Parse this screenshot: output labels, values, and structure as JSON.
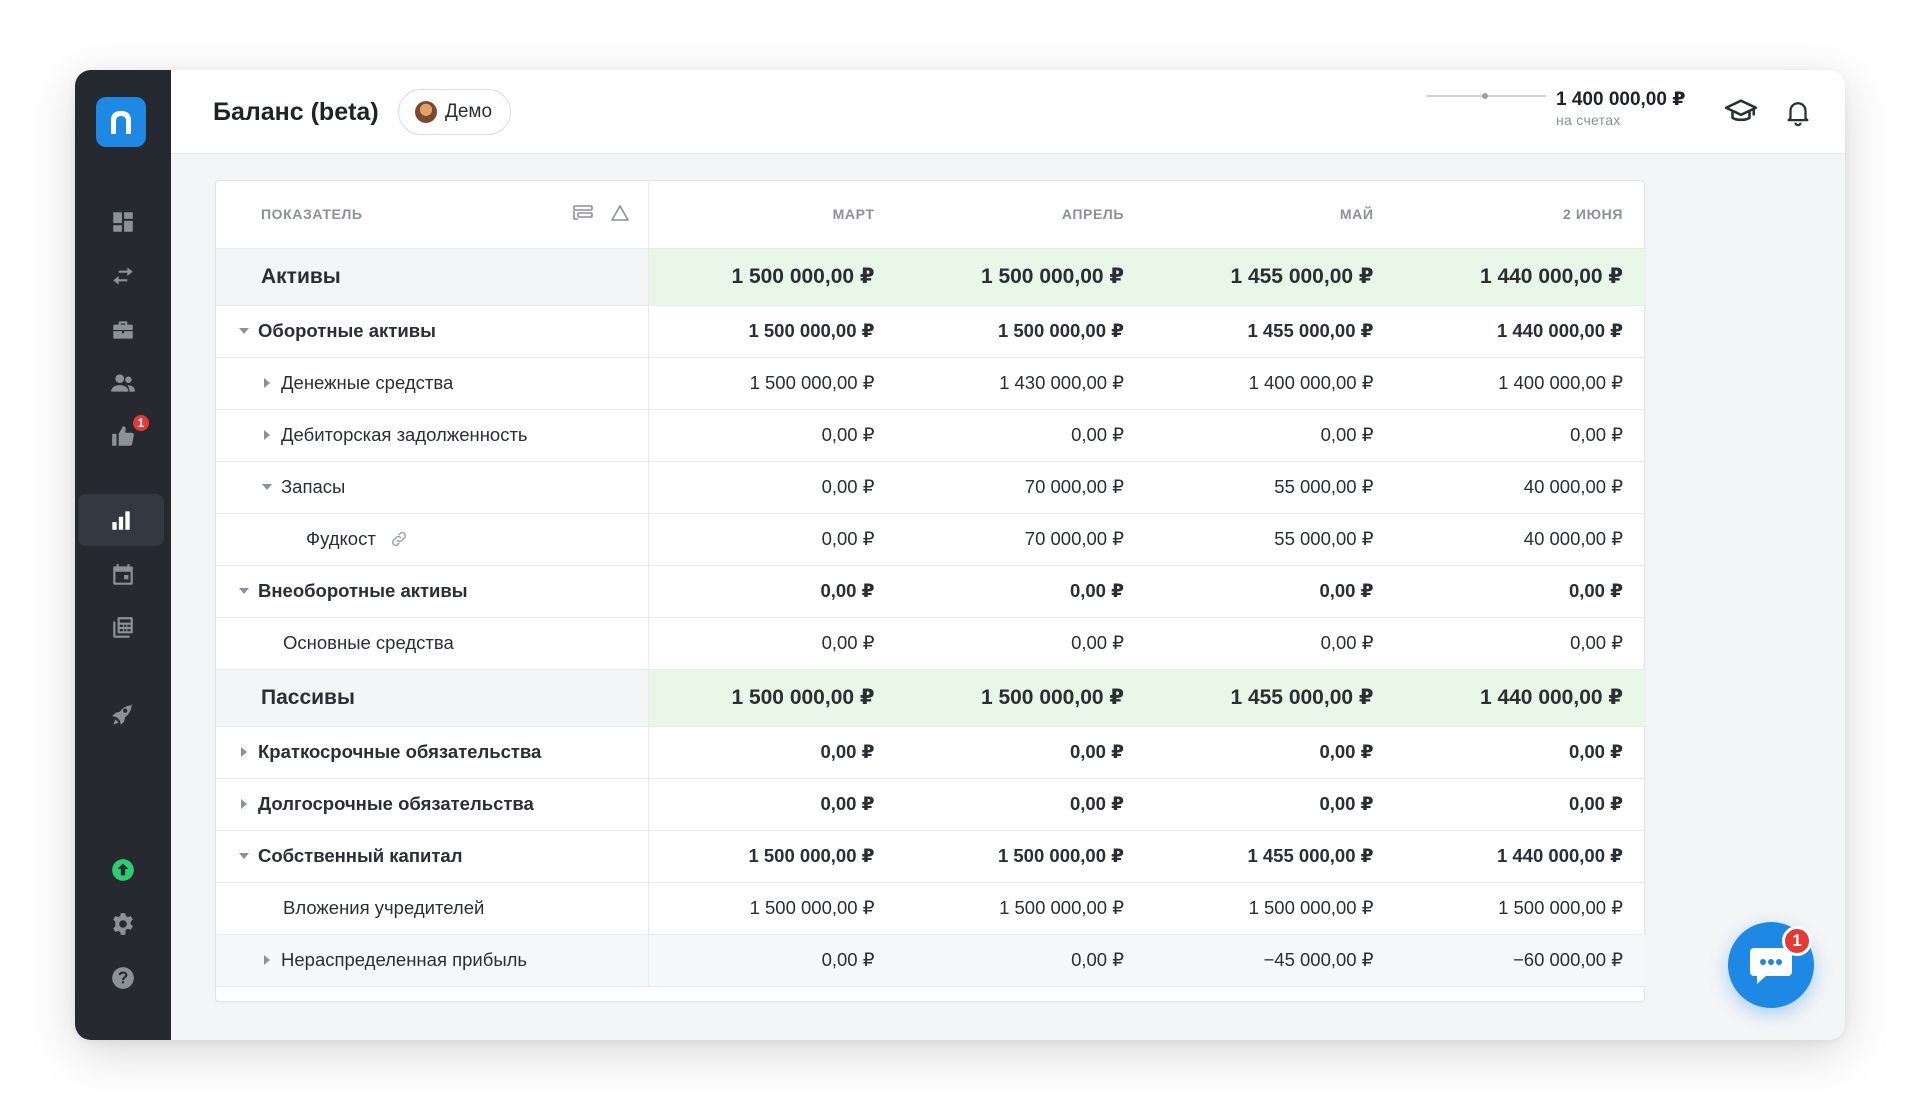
{
  "header": {
    "title": "Баланс (beta)",
    "demo_label": "Демо",
    "balance_amount": "1 400 000,00 ₽",
    "balance_caption": "на счетах"
  },
  "sidebar": {
    "items": [
      {
        "icon": "dashboard-icon"
      },
      {
        "icon": "transfer-arrows-icon"
      },
      {
        "icon": "briefcase-icon"
      },
      {
        "icon": "people-icon"
      },
      {
        "icon": "thumbs-up-icon",
        "badge": "1"
      },
      {
        "icon": "bar-chart-icon",
        "active": true
      },
      {
        "icon": "calendar-icon"
      },
      {
        "icon": "calculator-icon"
      },
      {
        "icon": "rocket-icon"
      },
      {
        "icon": "upload-circle-icon"
      },
      {
        "icon": "gear-icon"
      },
      {
        "icon": "help-icon"
      }
    ],
    "accent": "#2ecc71"
  },
  "table": {
    "columns": [
      "ПОКАЗАТЕЛЬ",
      "МАРТ",
      "АПРЕЛЬ",
      "МАЙ",
      "2 ИЮНЯ"
    ],
    "rows": [
      {
        "label": "Активы",
        "values": [
          "1 500 000,00 ₽",
          "1 500 000,00 ₽",
          "1 455 000,00 ₽",
          "1 440 000,00 ₽"
        ]
      },
      {
        "label": "Оборотные активы",
        "values": [
          "1 500 000,00 ₽",
          "1 500 000,00 ₽",
          "1 455 000,00 ₽",
          "1 440 000,00 ₽"
        ]
      },
      {
        "label": "Денежные средства",
        "values": [
          "1 500 000,00 ₽",
          "1 430 000,00 ₽",
          "1 400 000,00 ₽",
          "1 400 000,00 ₽"
        ]
      },
      {
        "label": "Дебиторская задолженность",
        "values": [
          "0,00 ₽",
          "0,00 ₽",
          "0,00 ₽",
          "0,00 ₽"
        ]
      },
      {
        "label": "Запасы",
        "values": [
          "0,00 ₽",
          "70 000,00 ₽",
          "55 000,00 ₽",
          "40 000,00 ₽"
        ]
      },
      {
        "label": "Фудкост",
        "values": [
          "0,00 ₽",
          "70 000,00 ₽",
          "55 000,00 ₽",
          "40 000,00 ₽"
        ]
      },
      {
        "label": "Внеоборотные активы",
        "values": [
          "0,00 ₽",
          "0,00 ₽",
          "0,00 ₽",
          "0,00 ₽"
        ]
      },
      {
        "label": "Основные средства",
        "values": [
          "0,00 ₽",
          "0,00 ₽",
          "0,00 ₽",
          "0,00 ₽"
        ]
      },
      {
        "label": "Пассивы",
        "values": [
          "1 500 000,00 ₽",
          "1 500 000,00 ₽",
          "1 455 000,00 ₽",
          "1 440 000,00 ₽"
        ]
      },
      {
        "label": "Краткосрочные обязательства",
        "values": [
          "0,00 ₽",
          "0,00 ₽",
          "0,00 ₽",
          "0,00 ₽"
        ]
      },
      {
        "label": "Долгосрочные обязательства",
        "values": [
          "0,00 ₽",
          "0,00 ₽",
          "0,00 ₽",
          "0,00 ₽"
        ]
      },
      {
        "label": "Собственный капитал",
        "values": [
          "1 500 000,00 ₽",
          "1 500 000,00 ₽",
          "1 455 000,00 ₽",
          "1 440 000,00 ₽"
        ]
      },
      {
        "label": "Вложения учредителей",
        "values": [
          "1 500 000,00 ₽",
          "1 500 000,00 ₽",
          "1 500 000,00 ₽",
          "1 500 000,00 ₽"
        ]
      },
      {
        "label": "Нераспределенная прибыль",
        "values": [
          "0,00 ₽",
          "0,00 ₽",
          "−45 000,00 ₽",
          "−60 000,00 ₽"
        ]
      }
    ]
  },
  "chat": {
    "badge": "1"
  },
  "colors": {
    "brand": "#1e88e5",
    "sidebar_bg": "#262a30",
    "section_highlight": "#e8f7e8",
    "badge": "#e53935"
  }
}
